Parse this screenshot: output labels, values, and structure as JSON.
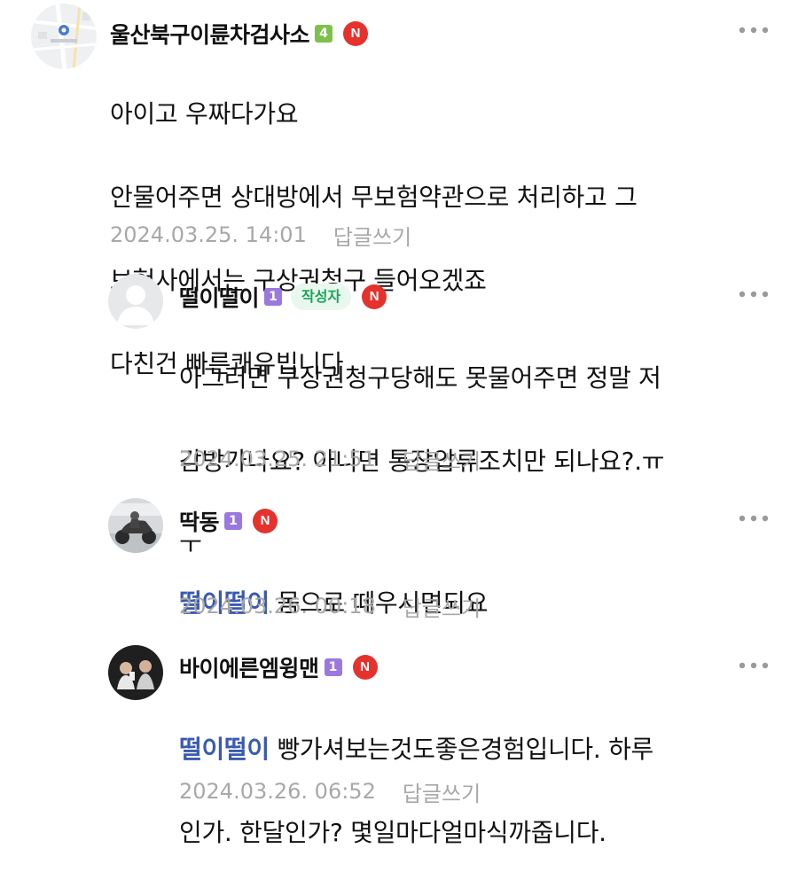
{
  "comments": [
    {
      "nickname": "울산북구이륜차검사소",
      "level": "4",
      "writer_badge": "",
      "new_badge": "N",
      "mention": "",
      "lines": [
        "아이고 우짜다가요",
        "안물어주면 상대방에서 무보험약관으로 처리하고 그",
        "보험사에서는 구상권청구 들어오겠죠",
        "다친건 빠른쾌유빕니다"
      ],
      "date": "2024.03.25. 14:01",
      "reply_label": "답글쓰기",
      "avatar": "map-thumbnail-icon"
    },
    {
      "nickname": "떨이떨이",
      "level": "1",
      "writer_badge": "작성자",
      "new_badge": "N",
      "mention": "",
      "lines": [
        "아그러면 구상권청구당해도 못물어주면 정말 저",
        "감방가나요? 아니면 통장압류조치만 되나요?.ㅠ",
        "ㅜ"
      ],
      "date": "2024.03.25. 21:51",
      "reply_label": "답글쓰기",
      "avatar": "default-profile-icon"
    },
    {
      "nickname": "딱동",
      "level": "1",
      "writer_badge": "",
      "new_badge": "N",
      "mention": "떨이떨이",
      "lines": [
        "몸으로 떼우시면되요"
      ],
      "date": "2024.03.26. 00:18",
      "reply_label": "답글쓰기",
      "avatar": "motorcycle-photo-icon"
    },
    {
      "nickname": "바이에른엠윙맨",
      "level": "1",
      "writer_badge": "",
      "new_badge": "N",
      "mention": "떨이떨이",
      "lines": [
        "빵가셔보는것도좋은경험입니다. 하루",
        "인가. 한달인가? 몇일마다얼마식까줍니다."
      ],
      "date": "2024.03.26. 06:52",
      "reply_label": "답글쓰기",
      "avatar": "person-photo-icon"
    }
  ],
  "colors": {
    "mention": "#3a5ab0",
    "new_badge": "#e5322d",
    "writer_badge_text": "#19a556",
    "writer_badge_bg": "#e9f8ee",
    "level_green": "#7cc24a",
    "level_purple": "#9a78e0",
    "meta_text": "#a8a8a8"
  }
}
